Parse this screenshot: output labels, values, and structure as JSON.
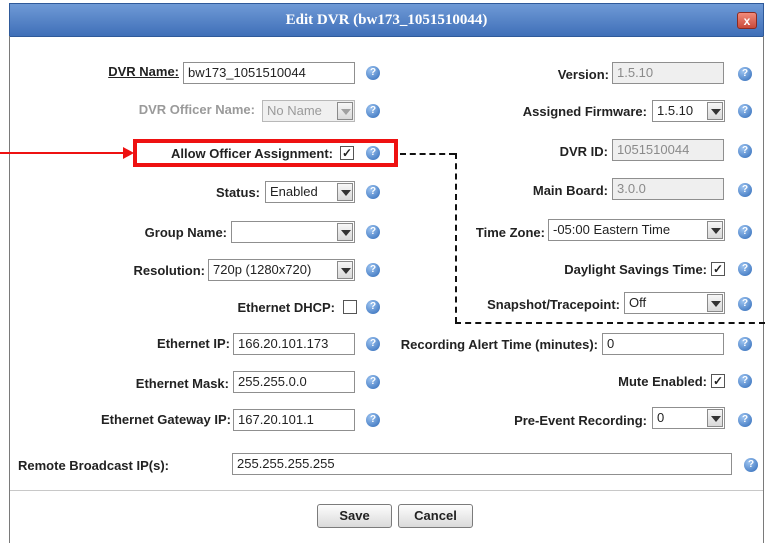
{
  "dialog": {
    "title": "Edit DVR (bw173_1051510044)",
    "close_glyph": "x"
  },
  "left": {
    "dvr_name": {
      "label": "DVR Name:",
      "value": "bw173_1051510044"
    },
    "dvr_officer_name": {
      "label": "DVR Officer Name:",
      "value": "No Name"
    },
    "allow_officer_assignment": {
      "label": "Allow Officer Assignment:",
      "checked": true
    },
    "status": {
      "label": "Status:",
      "value": "Enabled"
    },
    "group_name": {
      "label": "Group Name:",
      "value": ""
    },
    "resolution": {
      "label": "Resolution:",
      "value": "720p (1280x720)"
    },
    "ethernet_dhcp": {
      "label": "Ethernet DHCP:",
      "checked": false
    },
    "ethernet_ip": {
      "label": "Ethernet IP:",
      "value": "166.20.101.173"
    },
    "ethernet_mask": {
      "label": "Ethernet Mask:",
      "value": "255.255.0.0"
    },
    "ethernet_gateway_ip": {
      "label": "Ethernet Gateway IP:",
      "value": "167.20.101.1"
    }
  },
  "right": {
    "version": {
      "label": "Version:",
      "value": "1.5.10"
    },
    "assigned_firmware": {
      "label": "Assigned Firmware:",
      "value": "1.5.10"
    },
    "dvr_id": {
      "label": "DVR ID:",
      "value": "1051510044"
    },
    "main_board": {
      "label": "Main Board:",
      "value": "3.0.0"
    },
    "time_zone": {
      "label": "Time Zone:",
      "value": "-05:00 Eastern Time"
    },
    "daylight_savings": {
      "label": "Daylight Savings Time:",
      "checked": true
    },
    "snapshot_tracepoint": {
      "label": "Snapshot/Tracepoint:",
      "value": "Off"
    },
    "recording_alert_time": {
      "label": "Recording Alert Time (minutes):",
      "value": "0"
    },
    "mute_enabled": {
      "label": "Mute Enabled:",
      "checked": true
    },
    "pre_event_recording": {
      "label": "Pre-Event Recording:",
      "value": "0"
    }
  },
  "remote_broadcast": {
    "label": "Remote Broadcast IP(s):",
    "value": "255.255.255.255"
  },
  "buttons": {
    "save": "Save",
    "cancel": "Cancel"
  },
  "icons": {
    "help_glyph": "?",
    "check_glyph": "✓"
  },
  "colors": {
    "title_bar": "#3f6fb8",
    "highlight": "#ee1111",
    "help_icon": "#2f6ab8"
  }
}
